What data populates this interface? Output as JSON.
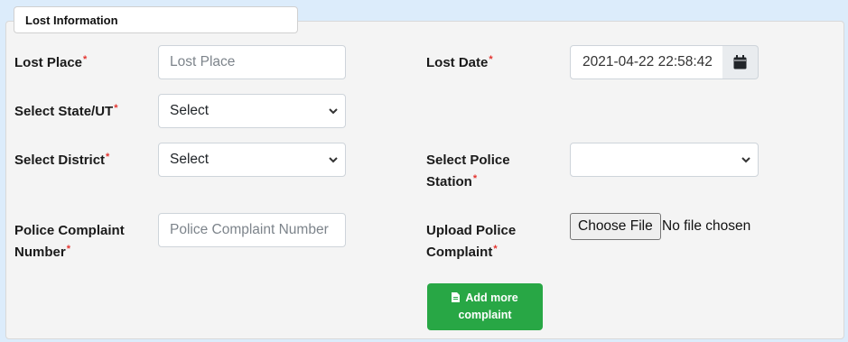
{
  "section": {
    "legend": "Lost Information"
  },
  "form": {
    "required_mark": "*",
    "lost_place": {
      "label": "Lost Place",
      "placeholder": "Lost Place"
    },
    "lost_date": {
      "label": "Lost Date",
      "value": "2021-04-22 22:58:42",
      "button_icon": "calendar-icon"
    },
    "state": {
      "label": "Select State/UT",
      "selected": "Select"
    },
    "district": {
      "label": "Select District",
      "selected": "Select"
    },
    "police_station": {
      "label_line1": "Select Police",
      "label_line2": "Station",
      "selected": ""
    },
    "complaint_number": {
      "label_line1": "Police Complaint",
      "label_line2": "Number",
      "placeholder": "Police Complaint Number"
    },
    "upload_complaint": {
      "label_line1": "Upload Police",
      "label_line2": "Complaint",
      "button_label": "Choose File",
      "status": "No file chosen"
    },
    "add_more": {
      "line1": "Add more",
      "line2": "complaint",
      "icon": "file-icon"
    }
  },
  "colors": {
    "page_background": "#dcecfb",
    "panel_background": "#f4f4f4",
    "required": "#e3342f",
    "success_button": "#28a745"
  }
}
